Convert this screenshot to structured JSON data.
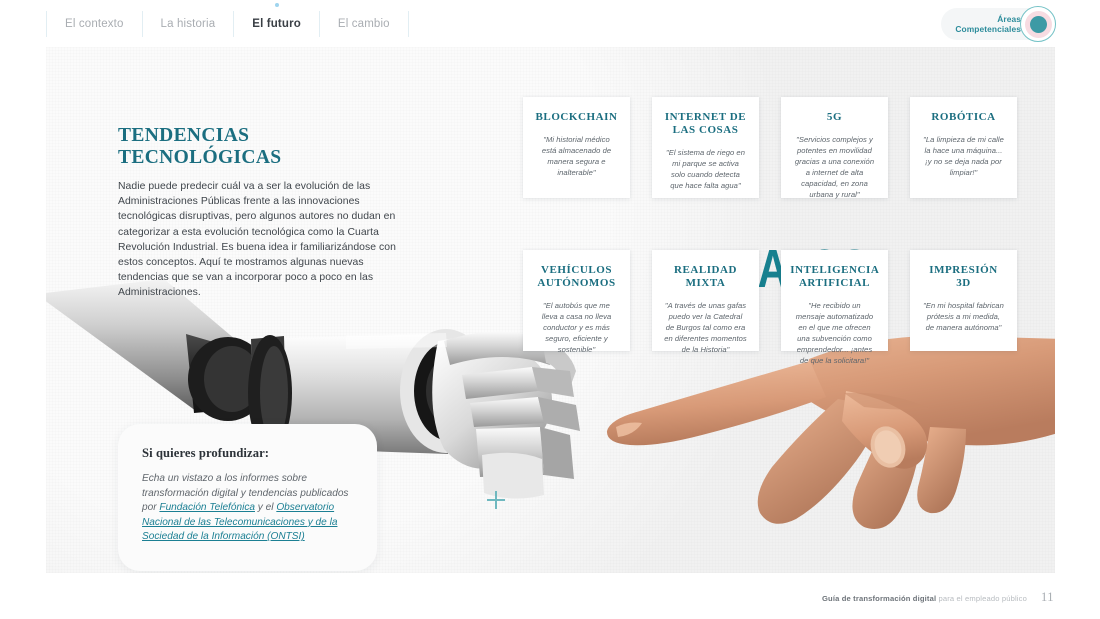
{
  "nav": {
    "tabs": [
      {
        "label": "El contexto",
        "active": false
      },
      {
        "label": "La historia",
        "active": false
      },
      {
        "label": "El futuro",
        "active": true
      },
      {
        "label": "El cambio",
        "active": false
      }
    ],
    "areas_badge": {
      "line1": "Áreas",
      "line2": "Competenciales"
    }
  },
  "intro": {
    "title_line1": "TENDENCIAS",
    "title_line2": "TECNOLÓGICAS",
    "body": "Nadie puede predecir cuál va a ser la evolución de las Administraciones Públicas frente a las innovaciones tecnológicas disruptivas, pero algunos autores no dudan en categorizar a esta evolución tecnológica como la Cuarta Revolución Industrial. Es buena idea ir familiarizándose con estos conceptos. Aquí te mostramos algunas nuevas tendencias que se van a incorporar poco a poco en las Administraciones."
  },
  "watermark": {
    "datos": "DATOS"
  },
  "cards": [
    {
      "id": "blockchain",
      "title": "BLOCKCHAIN",
      "quote": "\"Mi historial médico está almacenado de manera segura e inalterable\""
    },
    {
      "id": "internet-de-las-cosas",
      "title": "INTERNET DE LAS COSAS",
      "quote": "\"El sistema de riego en mi parque se activa solo cuando detecta que hace falta agua\""
    },
    {
      "id": "5g",
      "title": "5G",
      "quote": "\"Servicios complejos y potentes en movilidad gracias a una conexión a internet de alta capacidad, en zona urbana y rural\""
    },
    {
      "id": "robotica",
      "title": "ROBÓTICA",
      "quote": "\"La limpieza de mi calle la hace una máquina... ¡y no se deja nada por limpiar!\""
    },
    {
      "id": "vehiculos-autonomos",
      "title": "VEHÍCULOS AUTÓNOMOS",
      "quote": "\"El autobús que me lleva a casa no lleva conductor y es más seguro, eficiente y sostenible\""
    },
    {
      "id": "realidad-mixta",
      "title": "REALIDAD MIXTA",
      "quote": "\"A través de unas gafas puedo ver la Catedral de Burgos tal como era en diferentes momentos de la Historia\""
    },
    {
      "id": "inteligencia-artificial",
      "title": "INTELIGENCIA ARTIFICIAL",
      "quote": "\"He recibido un mensaje automatizado en el que me ofrecen una subvención como emprendedor... ¡antes de que la solicitara!\""
    },
    {
      "id": "impresion-3d",
      "title": "IMPRESIÓN 3D",
      "quote": "\"En mi hospital fabrican prótesis a mi medida, de manera autónoma\""
    }
  ],
  "deep_dive": {
    "title": "Si quieres profundizar:",
    "text_before": "Echa un vistazo a los informes sobre transformación digital  y tendencias publicados por ",
    "link1": "Fundación Telefónica",
    "text_middle": " y el ",
    "link2": "Observatorio Nacional de las Telecomunicaciones y de la Sociedad de la Información (ONTSI)"
  },
  "footer": {
    "title_strong": "Guía de  transformación digital",
    "title_rest": "para el empleado público",
    "page_number": "11"
  },
  "colors": {
    "brand_teal": "#1b6e80",
    "accent_teal": "#17808f",
    "badge_teal": "#2c8c9b",
    "canvas": "#f1f1f1",
    "dot_blue": "#9fd4ee",
    "pink_ring": "#f7dce2"
  }
}
